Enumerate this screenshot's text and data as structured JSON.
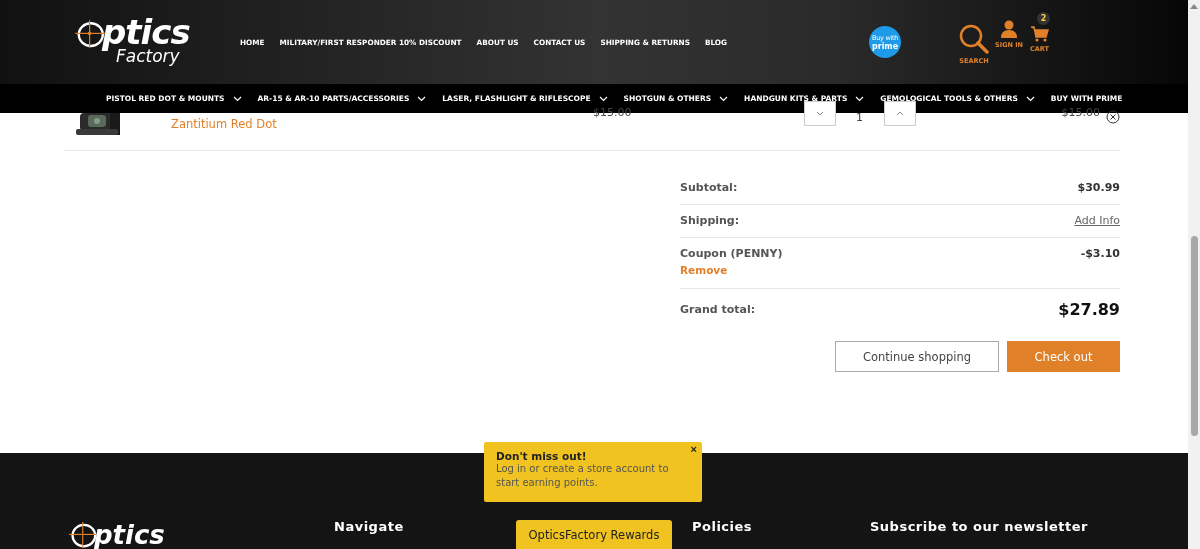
{
  "header": {
    "logo": {
      "word": "ptics",
      "subword": "Factory"
    },
    "nav": [
      "HOME",
      "MILITARY/FIRST RESPONDER 10% DISCOUNT",
      "ABOUT US",
      "CONTACT US",
      "SHIPPING & RETURNS",
      "BLOG"
    ],
    "prime_badge": {
      "line1": "Buy with",
      "line2": "prime"
    },
    "actions": [
      {
        "kind": "search",
        "label": "SEARCH"
      },
      {
        "kind": "account",
        "label": "SIGN IN"
      },
      {
        "kind": "cart",
        "label": "CART",
        "count": "2"
      }
    ]
  },
  "categories": [
    {
      "label": "PISTOL RED DOT & MOUNTS",
      "expandable": true
    },
    {
      "label": "AR-15 & AR-10 PARTS/ACCESSORIES",
      "expandable": true
    },
    {
      "label": "LASER, FLASHLIGHT & RIFLESCOPE",
      "expandable": true
    },
    {
      "label": "SHOTGUN & OTHERS",
      "expandable": true
    },
    {
      "label": "HANDGUN KITS & PARTS",
      "expandable": true
    },
    {
      "label": "GEMOLOGICAL TOOLS & OTHERS",
      "expandable": true
    },
    {
      "label": "BUY WITH PRIME",
      "expandable": false
    }
  ],
  "cart_item": {
    "name": "Zantitium Red Dot",
    "price": "$15.00",
    "quantity": "1",
    "total": "$15.00"
  },
  "summary": {
    "rows": [
      {
        "kind": "plain",
        "label": "Subtotal:",
        "value": "$30.99"
      },
      {
        "kind": "link",
        "label": "Shipping:",
        "value": "Add Info"
      },
      {
        "kind": "coupon",
        "label": "Coupon (PENNY)",
        "action": "Remove",
        "value": "-$3.10"
      },
      {
        "kind": "total",
        "label": "Grand total:",
        "value": "$27.89"
      }
    ],
    "buttons": [
      {
        "kind": "secondary",
        "label": "Continue shopping"
      },
      {
        "kind": "primary",
        "label": "Check out"
      }
    ]
  },
  "footer": {
    "logo_word": "ptics",
    "headings": [
      "Navigate",
      "Policies",
      "Subscribe to our newsletter"
    ]
  },
  "popup": {
    "title": "Don't miss out!",
    "message": "Log in or create a store account to start earning points.",
    "close": "×"
  },
  "rewards_button": "OpticsFactory Rewards"
}
